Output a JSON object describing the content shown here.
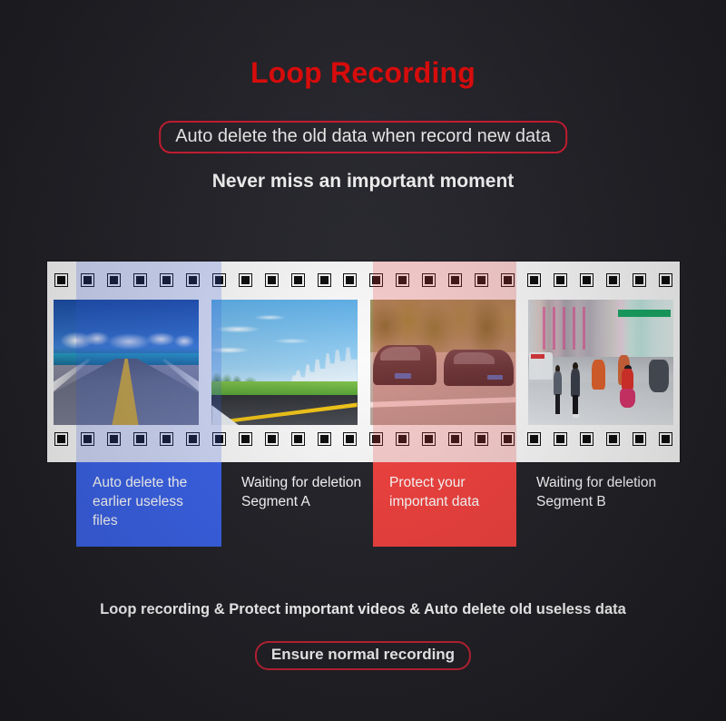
{
  "header": {
    "title": "Loop Recording",
    "highlight_box": "Auto delete the old data when record new data",
    "tagline": "Never miss an important moment"
  },
  "filmstrip": {
    "sprocket_count": 24,
    "frames": [
      {
        "icon": "highway-over-sea-photo",
        "alt": "Open highway crossing blue sea under clouds"
      },
      {
        "icon": "city-skyline-road-photo",
        "alt": "Road beside green grass with city skyline"
      },
      {
        "icon": "car-collision-photo",
        "alt": "Two dark cars collided on a street"
      },
      {
        "icon": "busy-street-photo",
        "alt": "Pedestrians and scooters on a busy shopping street"
      }
    ],
    "washes": [
      {
        "name": "blue-wash",
        "color": "#3b63ea"
      },
      {
        "name": "red-wash",
        "color": "#f2423f"
      }
    ]
  },
  "captions": [
    {
      "name": "caption-auto-delete",
      "text": "Auto delete the earlier useless files",
      "background": "#3b63ea"
    },
    {
      "name": "caption-segment-a",
      "text": "Waiting for deletion Segment A",
      "background": "transparent"
    },
    {
      "name": "caption-protect",
      "text": "Protect your important data",
      "background": "#f2423f"
    },
    {
      "name": "caption-segment-b",
      "text": "Waiting for deletion Segment B",
      "background": "transparent"
    }
  ],
  "footer": {
    "summary": "Loop recording & Protect important videos & Auto delete old useless data",
    "badge": "Ensure normal recording"
  },
  "colors": {
    "background": "#232329",
    "title_red": "#f60c0c",
    "border_red": "#d81f35",
    "blue": "#3b63ea",
    "red": "#f2423f",
    "film_white": "#fbfbfb",
    "hole_black": "#0d0d0d"
  }
}
